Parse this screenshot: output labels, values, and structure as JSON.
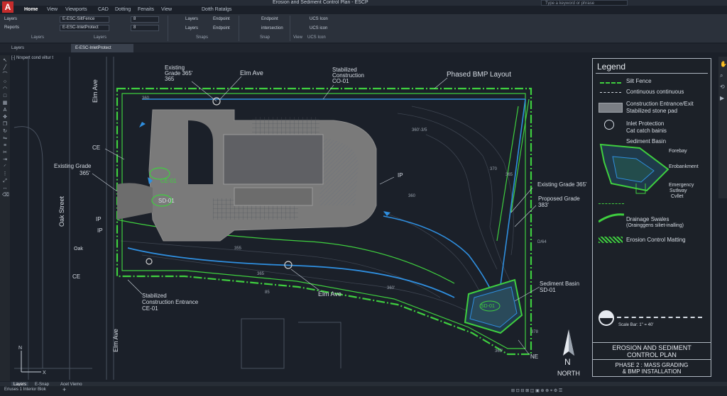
{
  "app": {
    "title": "Erosion and Sediment Control Plan - ESCP",
    "search_placeholder": "Type a keyword or phrase",
    "logo": "A"
  },
  "menu": [
    "Home",
    "View",
    "Viewports",
    "CAD",
    "Dotting",
    "Fenaits",
    "View",
    "Dotth Ratalgs"
  ],
  "ribbon": {
    "layers_label": "Layers",
    "reports_label": "Reports",
    "layer_dd1": "E-ESC-SiltFence",
    "layer_dd2": "E-ESC-InletProtect",
    "layer_num1": "8",
    "layer_num2": "8",
    "btn_layers": "Layers",
    "btn_layers2": "Layers",
    "btn_layers3": "Layers",
    "btn_endpoint": "Endpoint",
    "btn_endpoint2": "Endpoint",
    "btn_endpoint3": "Endpoint",
    "btn_intersection": "intersection",
    "btn_view": "View",
    "btn_ucs": "UCS Icon",
    "btn_ucs2": "UCS icon",
    "grp_layers": "Layers",
    "grp_layers2": "Layers",
    "grp_snaps": "Snaps",
    "grp_snap": "Snap",
    "grp_view": "View",
    "grp_ucs": "UCS Icon"
  },
  "tabs": {
    "t1": "Layers",
    "t2": "E-ESC-InletProtect"
  },
  "viewport_label": "[-] Nrxpert cond viltur t",
  "drawing": {
    "title": "Phased BMP Layout",
    "labels": {
      "existing_grade_top": "Existing",
      "existing_grade_top2": "Grade 365'",
      "existing_grade_top3": "365",
      "elm_ave_top": "Elm Ave",
      "stab_con1": "Stabilized",
      "stab_con2": "Construction",
      "stab_con3": "CO-01",
      "elm_ave_side": "Elm Ave",
      "elm_ave_side2": "Elm Ave",
      "oak_street": "Oak Street",
      "existing_grade_left": "Existing Grade",
      "existing_grade_left2": "365'",
      "ce1": "CE",
      "ce2": "CE",
      "ce01": "CE-01",
      "sd01": "SD-01",
      "ip1": "IP",
      "ip2": "IP",
      "ip3": "IP",
      "ip_center": "IP",
      "oak": "Oak",
      "ce01b": "CE-01",
      "stab_ent1": "Stabilized",
      "stab_ent2": "Construction Entrance",
      "stab_ent3": "CE-01",
      "elm_ave_bottom": "Elm Ave",
      "existing_grade_right": "Existing Grade 365'",
      "proposed_grade": "Proposed Grade",
      "proposed_grade2": "383'",
      "sediment_basin": "Sediment Basin",
      "sediment_basin2": "SD-01",
      "sd01_circle": "SD-01",
      "ne": "NE",
      "north": "NORTH",
      "north_n": "N",
      "c360": "360",
      "c365": "365",
      "c355": "355",
      "c370": "370",
      "c385": "385",
      "c380": "360",
      "c3603": "360'-3/5",
      "c365b": "365'",
      "c85": "85",
      "c378": "378",
      "c376": "376",
      "c368": "368",
      "c355b": "355",
      "c360d": "360'",
      "cd": "D/64"
    }
  },
  "legend": {
    "title": "Legend",
    "items": [
      {
        "label": "Silt Fence"
      },
      {
        "label": "Continuous continuous"
      },
      {
        "label": "Construction Entrance/Exit",
        "label2": "Stabilized stone pad"
      },
      {
        "label": "Inlet Protection",
        "label2": "Cat catch bainis"
      },
      {
        "label": "Sediment Basin"
      },
      {
        "label": "Forebay"
      },
      {
        "label": "Erobankment"
      },
      {
        "label": "Emergency",
        "label2": "Sutlway",
        "label3": "Cvllet"
      },
      {
        "label": "Drainage Swales",
        "label2": "(Orainggens siliet-inalling)"
      },
      {
        "label": "Erosion Control Matting"
      }
    ],
    "scale": "Scale Bar: 1\" = 40'",
    "plan_title1": "EROSION AND SEDIMENT",
    "plan_title2": "CONTROL PLAN",
    "phase1": "PHASE 2 : MASS GRADING",
    "phase2": "& BMP INSTALLATION"
  },
  "status": {
    "t1": "Layers",
    "t2": "E-Snap",
    "t3": "Acet Viemo",
    "t4": "Eriuses 1 Interior Blok",
    "t5": "+"
  },
  "colors": {
    "accent": "#3fcf3f",
    "blue": "#2f8fe0",
    "bg": "#1b2029",
    "pad": "#7a7a7a"
  }
}
